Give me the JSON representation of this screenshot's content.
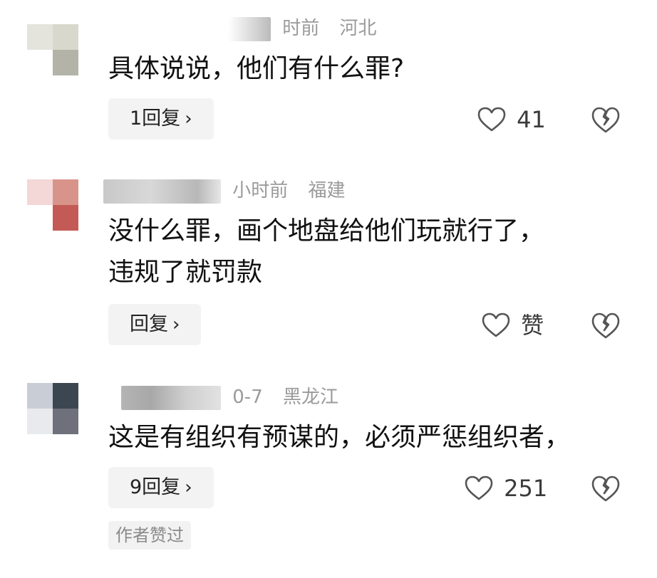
{
  "comments": [
    {
      "time": "时前",
      "region": "河北",
      "text": "具体说说，他们有什么罪?",
      "reply_label": "1回复",
      "reply_chevron": "›",
      "like_count": "41"
    },
    {
      "time": "小时前",
      "region": "福建",
      "text_lines": [
        "没什么罪，画个地盘给他们玩就行了，",
        "违规了就罚款"
      ],
      "reply_label": "回复",
      "reply_chevron": "›",
      "like_count": "赞"
    },
    {
      "time": "0-7",
      "region": "黑龙江",
      "text": "这是有组织有预谋的，必须严惩组织者，",
      "reply_label": "9回复",
      "reply_chevron": "›",
      "like_count": "251",
      "author_badge": "作者赞过"
    }
  ],
  "icons": {
    "like": "heart-outline-icon",
    "dislike": "broken-heart-icon",
    "chevron": "chevron-right-icon"
  },
  "colors": {
    "text": "#111111",
    "meta": "#9a9a9a",
    "button_bg": "#f3f3f3",
    "icon": "#555555"
  }
}
